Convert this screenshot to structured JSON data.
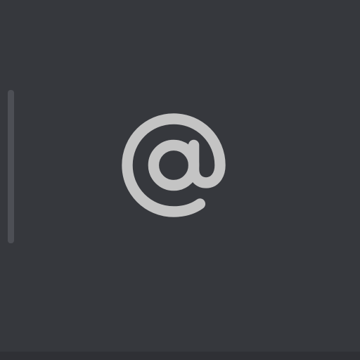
{
  "toolbar": {
    "mention_button": {
      "icon": "at-sign-icon",
      "color": "#c4c4c4"
    },
    "divider_color": "#4d4f55"
  },
  "theme": {
    "background": "#36383d",
    "bottom_strip": "#2f3035"
  }
}
